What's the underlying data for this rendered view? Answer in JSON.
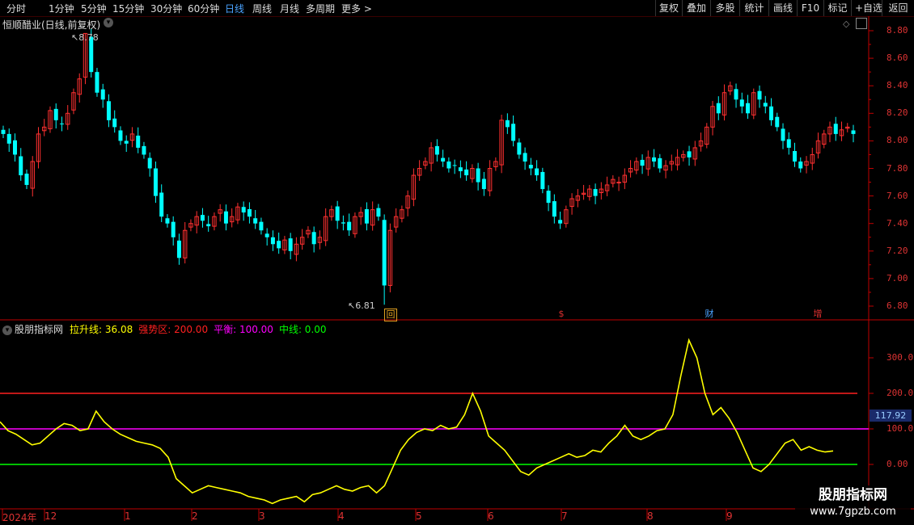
{
  "toolbar": {
    "periods": [
      "分时",
      "1分钟",
      "5分钟",
      "15分钟",
      "30分钟",
      "60分钟",
      "日线",
      "周线",
      "月线",
      "多周期",
      "更多 >"
    ],
    "active_period": "日线",
    "buttons": [
      "复权",
      "叠加",
      "多股",
      "统计",
      "画线",
      "F10",
      "标记",
      "+自选",
      "返回"
    ]
  },
  "main_panel": {
    "title": "恒顺醋业(日线,前复权)",
    "high_label": "8.78",
    "low_label": "6.81",
    "price_axis": [
      "8.80",
      "8.60",
      "8.40",
      "8.20",
      "8.00",
      "7.80",
      "7.60",
      "7.40",
      "7.20",
      "7.00",
      "6.80"
    ],
    "event_markers": [
      {
        "text": "回",
        "color": "#e0a020"
      },
      {
        "text": "$",
        "color": "#e03030"
      },
      {
        "text": "财",
        "color": "#4aa3ff"
      },
      {
        "text": "增",
        "color": "#e03030"
      }
    ]
  },
  "indicator_panel": {
    "name": "股朋指标网",
    "legend": [
      {
        "label": "拉升线: 36.08",
        "color": "#ffff00"
      },
      {
        "label": "强势区: 200.00",
        "color": "#ff2020"
      },
      {
        "label": "平衡: 100.00",
        "color": "#ff00ff"
      },
      {
        "label": "中线: 0.00",
        "color": "#00ff00"
      }
    ],
    "axis": [
      "300.0",
      "200.0",
      "100.0",
      "0.00"
    ],
    "current_value": "117.92"
  },
  "time_axis": [
    "2024年",
    "12",
    "1",
    "2",
    "3",
    "4",
    "5",
    "6",
    "7",
    "8",
    "9"
  ],
  "watermark": {
    "title": "股朋指标网",
    "url": "www.7gpzb.com"
  },
  "colors": {
    "up": "#ff3030",
    "down": "#00ffff",
    "yellow_line": "#ffff00",
    "strong": "#ff2020",
    "balance": "#ff00ff",
    "mid": "#00ff00",
    "axis_red": "#c00000"
  },
  "chart_data": [
    {
      "type": "candlestick",
      "title": "恒顺醋业(日线,前复权)",
      "x": [
        "2024年",
        "12",
        "1",
        "2",
        "3",
        "4",
        "5",
        "6",
        "7",
        "8",
        "9"
      ],
      "ylim": [
        6.75,
        8.85
      ],
      "closes": [
        8.05,
        7.98,
        7.9,
        7.75,
        7.68,
        7.85,
        8.05,
        8.1,
        8.22,
        8.15,
        8.12,
        8.2,
        8.35,
        8.45,
        8.78,
        8.5,
        8.35,
        8.3,
        8.15,
        8.1,
        8.0,
        7.98,
        8.05,
        7.95,
        7.9,
        7.8,
        7.6,
        7.45,
        7.4,
        7.3,
        7.15,
        7.35,
        7.4,
        7.45,
        7.42,
        7.38,
        7.45,
        7.5,
        7.4,
        7.45,
        7.52,
        7.48,
        7.45,
        7.4,
        7.35,
        7.3,
        7.25,
        7.22,
        7.28,
        7.2,
        7.25,
        7.3,
        7.35,
        7.25,
        7.3,
        7.45,
        7.5,
        7.42,
        7.4,
        7.35,
        7.45,
        7.48,
        7.4,
        7.5,
        7.45,
        6.95,
        7.35,
        7.45,
        7.5,
        7.6,
        7.75,
        7.8,
        7.85,
        7.95,
        7.9,
        7.85,
        7.8,
        7.82,
        7.78,
        7.75,
        7.8,
        7.7,
        7.65,
        7.8,
        7.85,
        8.15,
        8.1,
        8.0,
        7.9,
        7.85,
        7.8,
        7.75,
        7.65,
        7.55,
        7.45,
        7.4,
        7.5,
        7.58,
        7.6,
        7.62,
        7.65,
        7.6,
        7.65,
        7.68,
        7.72,
        7.7,
        7.75,
        7.8,
        7.85,
        7.82,
        7.88,
        7.85,
        7.8,
        7.82,
        7.85,
        7.88,
        7.9,
        7.88,
        7.95,
        8.0,
        8.1,
        8.25,
        8.2,
        8.35,
        8.4,
        8.3,
        8.25,
        8.2,
        8.35,
        8.3,
        8.25,
        8.15,
        8.1,
        8.0,
        7.95,
        7.85,
        7.8,
        7.85,
        7.9,
        8.0,
        8.05,
        8.1,
        8.05,
        8.08,
        8.1,
        8.05
      ],
      "high": 8.78,
      "low": 6.81
    },
    {
      "type": "line",
      "title": "股朋指标网",
      "ylim": [
        -150,
        380
      ],
      "series": [
        {
          "name": "拉升线",
          "color": "#ffff00",
          "values": [
            120,
            95,
            85,
            70,
            55,
            60,
            80,
            100,
            115,
            110,
            95,
            100,
            150,
            120,
            100,
            85,
            75,
            65,
            60,
            55,
            45,
            20,
            -40,
            -60,
            -80,
            -70,
            -60,
            -65,
            -70,
            -75,
            -80,
            -90,
            -95,
            -100,
            -110,
            -100,
            -95,
            -90,
            -105,
            -85,
            -80,
            -70,
            -60,
            -70,
            -75,
            -65,
            -60,
            -80,
            -60,
            -10,
            40,
            70,
            90,
            100,
            95,
            110,
            100,
            105,
            140,
            200,
            150,
            80,
            60,
            40,
            10,
            -20,
            -30,
            -10,
            0,
            10,
            20,
            30,
            20,
            25,
            40,
            35,
            60,
            80,
            110,
            80,
            70,
            80,
            95,
            100,
            140,
            250,
            350,
            300,
            200,
            140,
            160,
            130,
            90,
            40,
            -10,
            -20,
            0,
            30,
            60,
            70,
            40,
            50,
            40,
            35,
            38
          ]
        },
        {
          "name": "强势区",
          "color": "#ff2020",
          "values": [
            200
          ]
        },
        {
          "name": "平衡",
          "color": "#ff00ff",
          "values": [
            100
          ]
        },
        {
          "name": "中线",
          "color": "#00ff00",
          "values": [
            0
          ]
        }
      ]
    }
  ]
}
